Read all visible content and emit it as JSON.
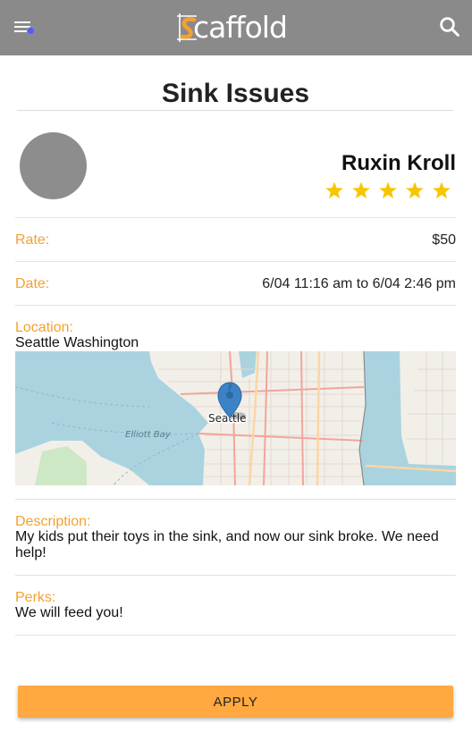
{
  "appbar": {
    "logo_text": "caffold",
    "background": "#8a8a8a",
    "menu_icon": "menu-icon",
    "search_icon": "search-icon"
  },
  "job": {
    "title": "Sink Issues",
    "poster_name": "Ruxin Kroll",
    "rating": 5,
    "rating_max": 5,
    "rate_label": "Rate:",
    "rate_value": "$50",
    "date_label": "Date:",
    "date_value": "6/04 11:16 am to 6/04 2:46 pm",
    "location_label": "Location:",
    "location_value": "Seattle Washington",
    "map_city_label": "Seattle",
    "map_bay_label": "Elliott Bay",
    "description_label": "Description:",
    "description_value": "My kids put their toys in the sink, and now our sink broke. We need help!",
    "perks_label": "Perks:",
    "perks_value": "We will feed you!"
  },
  "actions": {
    "apply_label": "APPLY"
  },
  "colors": {
    "accent_orange": "#f5a030",
    "button_orange": "#ffa940",
    "star_yellow": "#f7c600",
    "map_water": "#aad3df",
    "map_land": "#f2efe9"
  }
}
